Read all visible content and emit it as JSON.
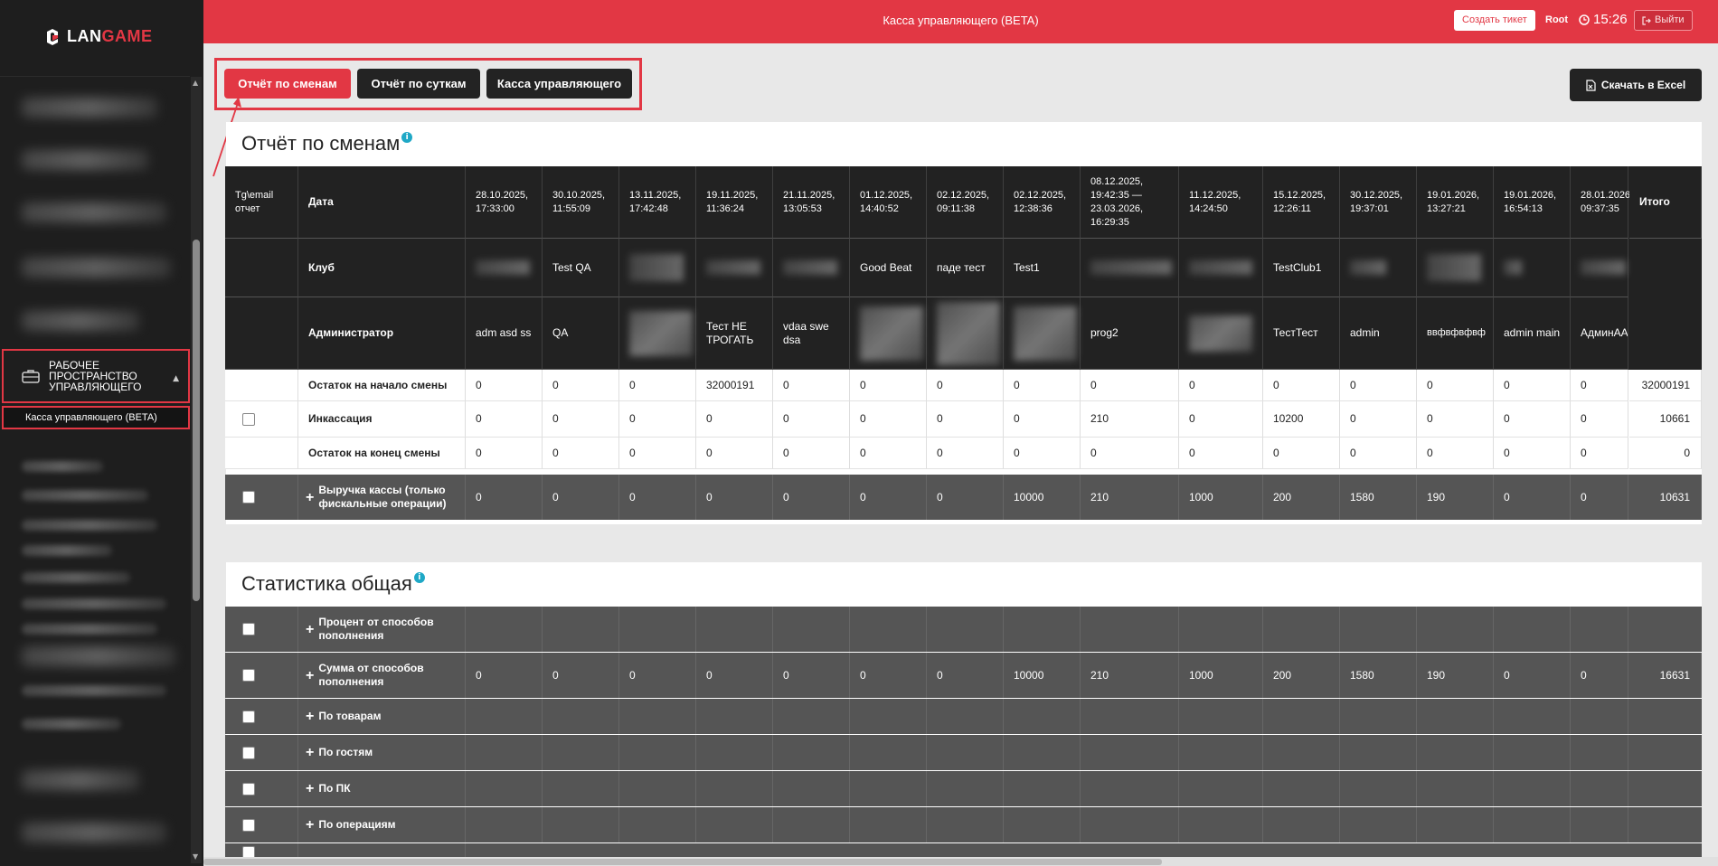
{
  "app": {
    "logo_prefix": "LAN",
    "logo_suffix": "GAME",
    "title": "Касса управляющего (BETA)"
  },
  "topbar": {
    "ticket_label": "Создать тикет",
    "user": "Root",
    "time": "15:26",
    "logout_label": "Выйти"
  },
  "sidebar": {
    "workspace_label": "РАБОЧЕЕ ПРОСТРАНСТВО УПРАВЛЯЮЩЕГО",
    "workspace_item": "Касса управляющего (BETA)"
  },
  "tabs": [
    {
      "label": "Отчёт по сменам",
      "active": true
    },
    {
      "label": "Отчёт по суткам",
      "active": false
    },
    {
      "label": "Касса управляющего",
      "active": false
    }
  ],
  "excel_label": "Скачать в Excel",
  "shifts": {
    "title": "Отчёт по сменам",
    "corner_label": "Tg\\email отчет",
    "date_label": "Дата",
    "club_label": "Клуб",
    "admin_label": "Администратор",
    "total_label": "Итого",
    "dates": [
      "28.10.2025, 17:33:00",
      "30.10.2025, 11:55:09",
      "13.11.2025, 17:42:48",
      "19.11.2025, 11:36:24",
      "21.11.2025, 13:05:53",
      "01.12.2025, 14:40:52",
      "02.12.2025, 09:11:38",
      "02.12.2025, 12:38:36",
      "08.12.2025, 19:42:35 — 23.03.2026, 16:29:35",
      "11.12.2025, 14:24:50",
      "15.12.2025, 12:26:11",
      "30.12.2025, 19:37:01",
      "19.01.2026, 13:27:21",
      "19.01.2026, 16:54:13",
      "28.01.2026, 09:37:35"
    ],
    "clubs": [
      "",
      "Test QA",
      "",
      "",
      "",
      "Good Beat",
      "паде тест",
      "Test1",
      "",
      "",
      "TestClub1",
      "",
      "",
      "",
      ""
    ],
    "admins": [
      "adm asd ss",
      "QA",
      "",
      "Тест НЕ ТРОГАТЬ",
      "vdaa swe dsa",
      "",
      "",
      "",
      "prog2",
      "",
      "ТестТест",
      "admin",
      "ввфвфвфвф",
      "admin main",
      "АдминАА"
    ],
    "rows": [
      {
        "label": "Остаток на начало смены",
        "values": [
          "0",
          "0",
          "0",
          "32000191",
          "0",
          "0",
          "0",
          "0",
          "0",
          "0",
          "0",
          "0",
          "0",
          "0",
          "0"
        ],
        "total": "32000191",
        "checkbox": false,
        "plus": false
      },
      {
        "label": "Инкассация",
        "values": [
          "0",
          "0",
          "0",
          "0",
          "0",
          "0",
          "0",
          "0",
          "210",
          "0",
          "10200",
          "0",
          "0",
          "0",
          "0"
        ],
        "total": "10661",
        "checkbox": true,
        "plus": false
      },
      {
        "label": "Остаток на конец смены",
        "values": [
          "0",
          "0",
          "0",
          "0",
          "0",
          "0",
          "0",
          "0",
          "0",
          "0",
          "0",
          "0",
          "0",
          "0",
          "0"
        ],
        "total": "0",
        "checkbox": false,
        "plus": false
      },
      {
        "label": "Выручка кассы (только фискальные операции)",
        "values": [
          "0",
          "0",
          "0",
          "0",
          "0",
          "0",
          "0",
          "10000",
          "210",
          "1000",
          "200",
          "1580",
          "190",
          "0",
          "0"
        ],
        "total": "10631",
        "checkbox": true,
        "plus": true
      }
    ]
  },
  "stats": {
    "title": "Статистика общая",
    "rows": [
      {
        "label": "Процент от способов пополнения",
        "values": [],
        "total": ""
      },
      {
        "label": "Сумма от способов пополнения",
        "values": [
          "0",
          "0",
          "0",
          "0",
          "0",
          "0",
          "0",
          "10000",
          "210",
          "1000",
          "200",
          "1580",
          "190",
          "0",
          "0"
        ],
        "total": "16631"
      },
      {
        "label": "По товарам",
        "values": [],
        "total": ""
      },
      {
        "label": "По гостям",
        "values": [],
        "total": ""
      },
      {
        "label": "По ПК",
        "values": [],
        "total": ""
      },
      {
        "label": "По операциям",
        "values": [],
        "total": ""
      }
    ]
  }
}
